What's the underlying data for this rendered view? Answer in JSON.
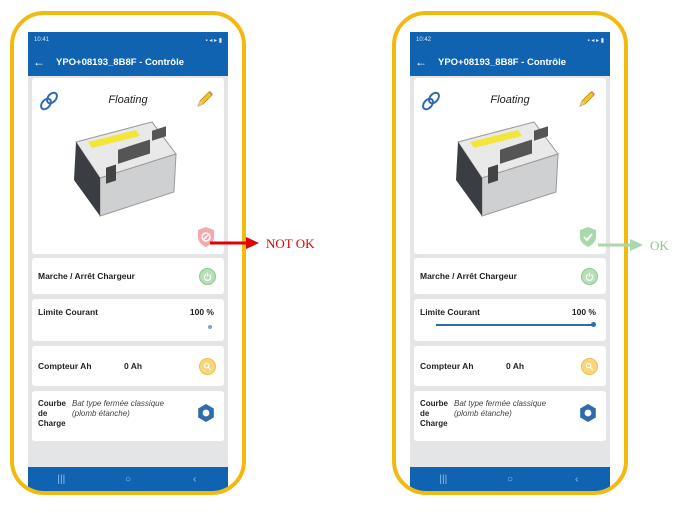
{
  "left_phone": {
    "status_time": "10:41",
    "status_icons": "▪ ◂ ▸ ▮",
    "app_title": "YPO+08193_8B8F - Contrôle",
    "mode": "Floating",
    "charger_label": "Marche / Arrêt Chargeur",
    "current_label": "Limite Courant",
    "current_value": "100 %",
    "current_slider_fraction": 0.0,
    "counter_label": "Compteur Ah",
    "counter_value": "0 Ah",
    "curve_label": "Courbe de Charge",
    "curve_desc": "Bat type fermée classique (plomb étanche)",
    "status_icon": "shield-x-icon"
  },
  "right_phone": {
    "status_time": "10:42",
    "status_icons": "▪ ◂ ▸ ▮",
    "app_title": "YPO+08193_8B8F - Contrôle",
    "mode": "Floating",
    "charger_label": "Marche / Arrêt Chargeur",
    "current_label": "Limite Courant",
    "current_value": "100 %",
    "current_slider_fraction": 1.0,
    "counter_label": "Compteur Ah",
    "counter_value": "0 Ah",
    "curve_label": "Courbe de Charge",
    "curve_desc": "Bat type fermée classique (plomb étanche)",
    "status_icon": "shield-check-icon"
  },
  "annotations": {
    "not_ok": "NOT OK",
    "ok": "OK",
    "not_ok_color": "#e00000",
    "ok_color": "#8cc98e"
  },
  "nav": {
    "recent": "|||",
    "home": "○",
    "back": "‹"
  },
  "colors": {
    "frame": "#f2b90f",
    "appbar": "#0f63b0"
  }
}
